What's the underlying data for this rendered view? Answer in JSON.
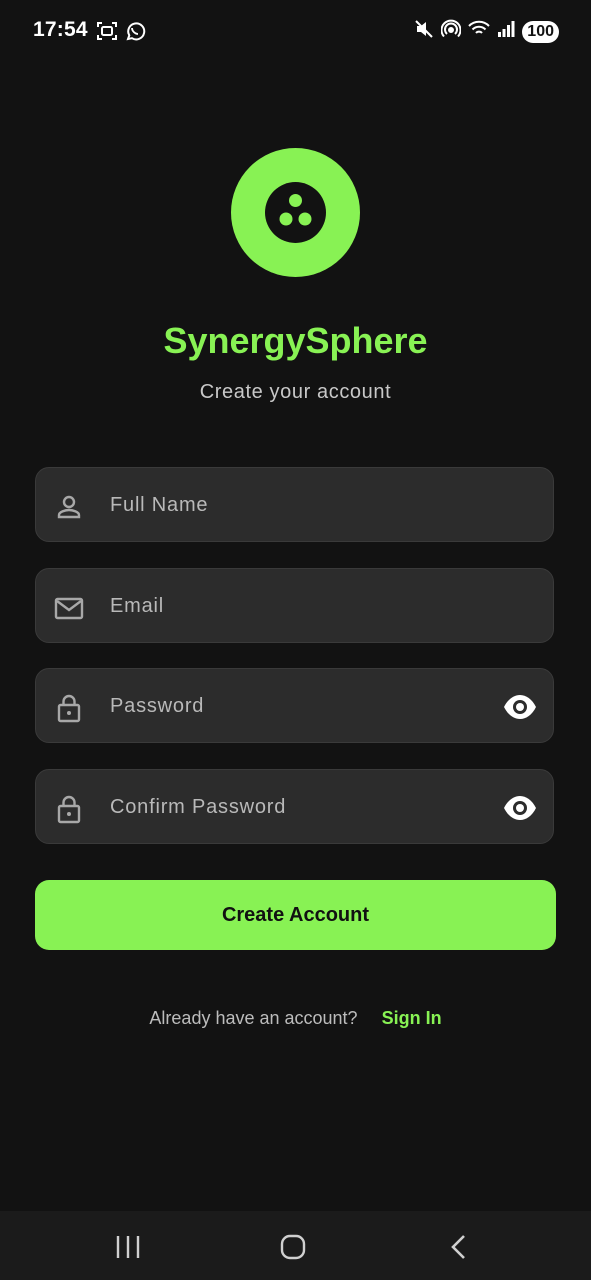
{
  "status_bar": {
    "time": "17:54",
    "battery": "100",
    "left_icons": [
      "screenshot-icon",
      "whatsapp-icon"
    ],
    "right_icons": [
      "mute-icon",
      "hotspot-icon",
      "wifi-icon",
      "signal-icon"
    ]
  },
  "brand": {
    "logo_icon": "three-dots-circle-logo",
    "title": "SynergySphere",
    "subtitle": "Create your account",
    "accent_color": "#88f254"
  },
  "form": {
    "full_name": {
      "placeholder": "Full Name",
      "icon": "person-icon"
    },
    "email": {
      "placeholder": "Email",
      "icon": "mail-icon"
    },
    "password": {
      "placeholder": "Password",
      "icon": "lock-icon",
      "toggle_icon": "eye-icon"
    },
    "confirm_password": {
      "placeholder": "Confirm Password",
      "icon": "lock-icon",
      "toggle_icon": "eye-icon"
    }
  },
  "actions": {
    "create_account_label": "Create Account",
    "signin_prompt": "Already have an account?",
    "signin_link": "Sign In"
  },
  "nav_bar": {
    "buttons": [
      "recents-icon",
      "home-icon",
      "back-icon"
    ]
  }
}
